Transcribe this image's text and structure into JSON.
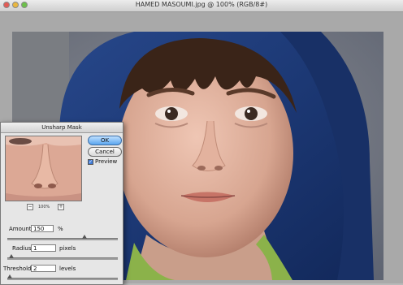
{
  "window": {
    "title": "HAMED MASOUMI.jpg @ 100% (RGB/8#)"
  },
  "dialog": {
    "title": "Unsharp Mask",
    "ok_label": "OK",
    "cancel_label": "Cancel",
    "preview_label": "Preview",
    "preview_checked": true,
    "zoom_minus": "−",
    "zoom_plus": "+",
    "zoom_level": "100%",
    "amount": {
      "label": "Amount:",
      "value": "150",
      "unit": "%",
      "slider_fraction": 0.7
    },
    "radius": {
      "label": "Radius:",
      "value": "1",
      "unit": "pixels",
      "slider_fraction": 0.04
    },
    "threshold": {
      "label": "Threshold:",
      "value": "2",
      "unit": "levels",
      "slider_fraction": 0.02
    }
  },
  "colors": {
    "accent": "#5aa5ef",
    "hood": "#1f3f7a",
    "skin": "#d7a996",
    "hair": "#3a2418"
  }
}
